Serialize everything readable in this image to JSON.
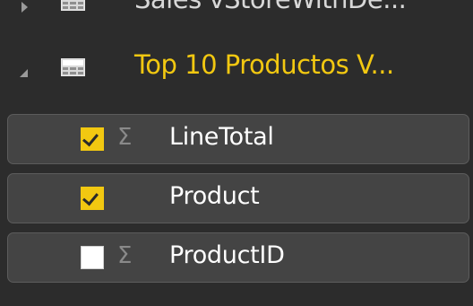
{
  "tables": [
    {
      "name": "Sales vStoreWithDe...",
      "expanded": false,
      "icon": "table-grid-icon"
    },
    {
      "name": "Top 10 Productos V...",
      "expanded": true,
      "icon": "table-grid-icon",
      "color": "#f2c811",
      "fields": [
        {
          "name": "LineTotal",
          "checked": true,
          "aggregate_icon": "sigma-icon",
          "aggregate_symbol": "Σ"
        },
        {
          "name": "Product",
          "checked": true,
          "aggregate_icon": null,
          "aggregate_symbol": ""
        },
        {
          "name": "ProductID",
          "checked": false,
          "aggregate_icon": "sigma-icon",
          "aggregate_symbol": "Σ"
        }
      ]
    }
  ],
  "colors": {
    "accent": "#f2c811",
    "field_bg": "#444444",
    "panel_bg": "#2c2c2c"
  }
}
